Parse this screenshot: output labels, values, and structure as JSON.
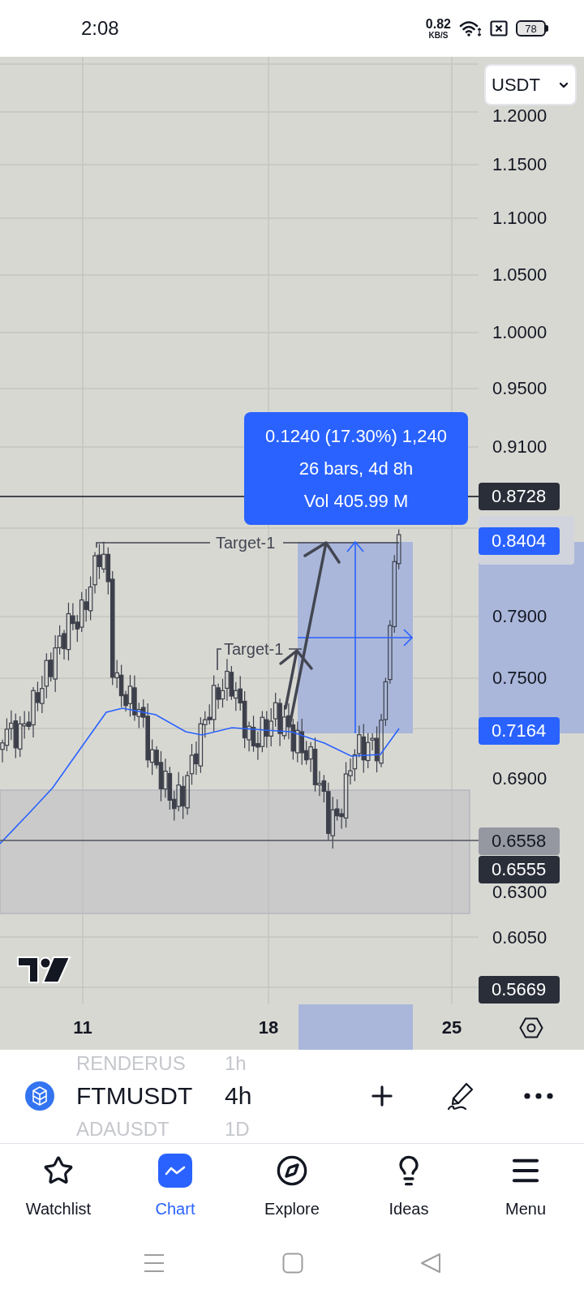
{
  "status_bar": {
    "time": "2:08",
    "net_speed": "0.82",
    "net_speed_unit": "KB/S",
    "battery": "78"
  },
  "chart": {
    "currency_select": {
      "value": "USDT"
    },
    "price_axis": [
      {
        "kind": "tick",
        "text": "1.2000"
      },
      {
        "kind": "tick",
        "text": "1.1500"
      },
      {
        "kind": "tick",
        "text": "1.1000"
      },
      {
        "kind": "tick",
        "text": "1.0500"
      },
      {
        "kind": "tick",
        "text": "1.0000"
      },
      {
        "kind": "tick",
        "text": "0.9500"
      },
      {
        "kind": "tick",
        "text": "0.9100"
      },
      {
        "kind": "tag",
        "text": "0.8728",
        "color": "#2a2e39"
      },
      {
        "kind": "tag",
        "text": "0.8404",
        "color": "#2962ff"
      },
      {
        "kind": "tick",
        "text": "0.7900"
      },
      {
        "kind": "tick",
        "text": "0.7500"
      },
      {
        "kind": "tag",
        "text": "0.7164",
        "color": "#2962ff"
      },
      {
        "kind": "tick",
        "text": "0.6900"
      },
      {
        "kind": "tag",
        "text": "0.6558",
        "color": "#9598a1"
      },
      {
        "kind": "tag",
        "text": "0.6555",
        "color": "#2a2e39"
      },
      {
        "kind": "tick",
        "text": "0.6300"
      },
      {
        "kind": "tick",
        "text": "0.6050"
      },
      {
        "kind": "tag",
        "text": "0.5669",
        "color": "#2a2e39"
      }
    ],
    "measurement": {
      "lines": [
        "0.1240 (17.30%) 1,240",
        "26 bars, 4d 8h",
        "Vol 405.99 M"
      ]
    },
    "target_labels": [
      "Target-1",
      "Target-1"
    ],
    "date_axis": [
      "11",
      "18",
      "25"
    ]
  },
  "symbol_bar": {
    "previous": {
      "symbol": "RENDERUS",
      "interval": "1h"
    },
    "current": {
      "symbol": "FTMUSDT",
      "interval": "4h"
    },
    "next": {
      "symbol": "ADAUSDT",
      "interval": "1D"
    }
  },
  "bottom_nav": [
    {
      "label": "Watchlist",
      "selected": false
    },
    {
      "label": "Chart",
      "selected": true
    },
    {
      "label": "Explore",
      "selected": false
    },
    {
      "label": "Ideas",
      "selected": false
    },
    {
      "label": "Menu",
      "selected": false
    }
  ]
}
